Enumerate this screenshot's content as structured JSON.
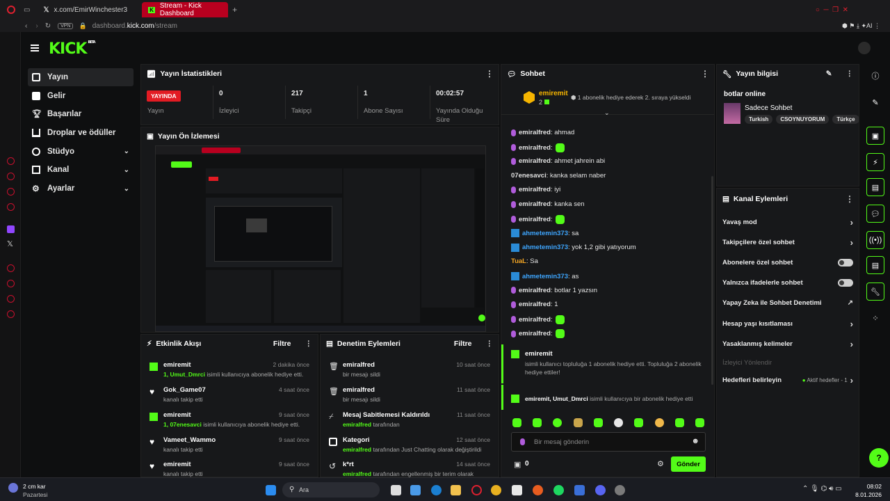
{
  "browser": {
    "tabs": [
      {
        "label": "x.com/EmirWinchester3"
      },
      {
        "label": "Stream - Kick Dashboard"
      }
    ],
    "url_host": "dashboard.",
    "url_domain": "kick.com",
    "url_path": "/stream",
    "vpn": "VPN"
  },
  "brand": {
    "logo": "KICK",
    "beta": "BETA",
    "accent": "#53fc18"
  },
  "sidebar": {
    "items": [
      {
        "label": "Yayın",
        "icon": "broadcast-icon"
      },
      {
        "label": "Gelir",
        "icon": "money-icon"
      },
      {
        "label": "Başarılar",
        "icon": "trophy-icon"
      },
      {
        "label": "Droplar ve ödüller",
        "icon": "gift-icon"
      },
      {
        "label": "Stüdyo",
        "icon": "studio-icon"
      },
      {
        "label": "Kanal",
        "icon": "channel-icon"
      },
      {
        "label": "Ayarlar",
        "icon": "gear-icon"
      }
    ]
  },
  "stats": {
    "title": "Yayın İstatistikleri",
    "live_badge": "YAYINDA",
    "items": [
      {
        "value": "0",
        "label": "İzleyici"
      },
      {
        "value": "217",
        "label": "Takipçi"
      },
      {
        "value": "1",
        "label": "Abone Sayısı"
      },
      {
        "value": "00:02:57",
        "label": "Yayında Olduğu Süre"
      }
    ],
    "status_label": "Yayın"
  },
  "preview": {
    "title": "Yayın Ön İzlemesi"
  },
  "activity": {
    "title": "Etkinlik Akışı",
    "filter": "Filtre",
    "items": [
      {
        "user": "emiremit",
        "time": "2 dakika önce",
        "sub_user": "1, Umut_Dmrci",
        "sub": " isimli kullanıcıya abonelik hediye etti."
      },
      {
        "user": "Gok_Game07",
        "time": "4 saat önce",
        "sub_user": "",
        "sub": "kanalı takip etti"
      },
      {
        "user": "emiremit",
        "time": "9 saat önce",
        "sub_user": "1, 07enesavci",
        "sub": " isimli kullanıcıya abonelik hediye etti."
      },
      {
        "user": "Vameet_Wammo",
        "time": "9 saat önce",
        "sub_user": "",
        "sub": "kanalı takip etti"
      },
      {
        "user": "emiremit",
        "time": "9 saat önce",
        "sub_user": "",
        "sub": "kanalı takip etti"
      }
    ]
  },
  "moderation": {
    "title": "Denetim Eylemleri",
    "filter": "Filtre",
    "items": [
      {
        "user": "emiralfred",
        "time": "10 saat önce",
        "sub_pre": "",
        "sub_user": "",
        "sub": "bir mesajı sildi"
      },
      {
        "user": "emiralfred",
        "time": "11 saat önce",
        "sub_pre": "",
        "sub_user": "",
        "sub": "bir mesajı sildi"
      },
      {
        "user": "Mesaj Sabitlemesi Kaldırıldı",
        "time": "11 saat önce",
        "sub_pre": "",
        "sub_user": "emiralfred",
        "sub": " tarafından"
      },
      {
        "user": "Kategori",
        "time": "12 saat önce",
        "sub_pre": "",
        "sub_user": "emiralfred",
        "sub": " tarafından Just Chatting olarak değiştirildi"
      },
      {
        "user": "k*rt",
        "time": "14 saat önce",
        "sub_pre": "",
        "sub_user": "emiralfred",
        "sub": " tarafından engellenmiş bir terim olarak"
      }
    ]
  },
  "chat": {
    "title": "Sohbet",
    "pinned_user": "emiremit",
    "pinned_count": "2",
    "pinned_text": "1 abonelik hediye ederek 2. sıraya yükseldi",
    "messages": [
      {
        "user": "emiralfred",
        "text": ": ahmad",
        "color": "#e2e2e2",
        "badge": "mic"
      },
      {
        "user": "emiralfred",
        "text": ":",
        "color": "#e2e2e2",
        "badge": "mic",
        "emote": true
      },
      {
        "user": "emiralfred",
        "text": ": ahmet jahrein abi",
        "color": "#e2e2e2",
        "badge": "mic"
      },
      {
        "user": "07enesavci",
        "text": ": kanka selam naber",
        "color": "#e2e2e2",
        "badge": ""
      },
      {
        "user": "emiralfred",
        "text": ": iyi",
        "color": "#e2e2e2",
        "badge": "mic"
      },
      {
        "user": "emiralfred",
        "text": ": kanka sen",
        "color": "#e2e2e2",
        "badge": "mic"
      },
      {
        "user": "emiralfred",
        "text": ":",
        "color": "#e2e2e2",
        "badge": "mic",
        "emote": true
      },
      {
        "user": "ahmetemin373",
        "text": ": sa",
        "color": "#3ea6ff",
        "badge": "kick"
      },
      {
        "user": "ahmetemin373",
        "text": ": yok 1,2 gibi yatıyorum",
        "color": "#3ea6ff",
        "badge": "kick"
      },
      {
        "user": "TuaL",
        "text": ": Sa",
        "color": "#f5a623",
        "badge": ""
      },
      {
        "user": "ahmetemin373",
        "text": ": as",
        "color": "#3ea6ff",
        "badge": "kick"
      },
      {
        "user": "emiralfred",
        "text": ": botlar 1 yazsın",
        "color": "#e2e2e2",
        "badge": "mic"
      },
      {
        "user": "emiralfred",
        "text": ": 1",
        "color": "#e2e2e2",
        "badge": "mic"
      },
      {
        "user": "emiralfred",
        "text": ":",
        "color": "#e2e2e2",
        "badge": "mic",
        "emote": true
      },
      {
        "user": "emiralfred",
        "text": ":",
        "color": "#e2e2e2",
        "badge": "mic",
        "emote": true
      }
    ],
    "gift_user": "emiremit",
    "gift_text": "isimli kullanıcı topluluğa 1 abonelik hediye etti. Topluluğa 2 abonelik hediye ettiler!",
    "gift2_user": "emiremit, Umut_Dmrci",
    "gift2_text": " isimli kullanıcıya bir abonelik hediye etti",
    "placeholder": "Bir mesaj gönderin",
    "count": "0",
    "send": "Gönder"
  },
  "info": {
    "title": "Yayın bilgisi",
    "stream_title": "botlar online",
    "category": "Sadece Sohbet",
    "tags": [
      "Turkish",
      "CSOYNUYORUM",
      "Türkçe"
    ]
  },
  "channel_actions": {
    "title": "Kanal Eylemleri",
    "items": [
      {
        "label": "Yavaş mod",
        "control": "chevron"
      },
      {
        "label": "Takipçilere özel sohbet",
        "control": "chevron"
      },
      {
        "label": "Abonelere özel sohbet",
        "control": "toggle"
      },
      {
        "label": "Yalnızca ifadelerle sohbet",
        "control": "toggle"
      },
      {
        "label": "Yapay Zeka ile Sohbet Denetimi",
        "control": "external"
      },
      {
        "label": "Hesap yaşı kısıtlaması",
        "control": "chevron"
      },
      {
        "label": "Yasaklanmış kelimeler",
        "control": "chevron"
      },
      {
        "label": "İzleyici Yönlendir",
        "control": "none"
      },
      {
        "label": "Hedefleri belirleyin",
        "control": "chevron"
      }
    ],
    "goals_active": "Aktif hedefler - 1"
  },
  "taskbar": {
    "weather": "2 cm kar",
    "day": "Pazartesi",
    "search": "Ara",
    "time": "08:02",
    "date": "8.01.2026"
  }
}
